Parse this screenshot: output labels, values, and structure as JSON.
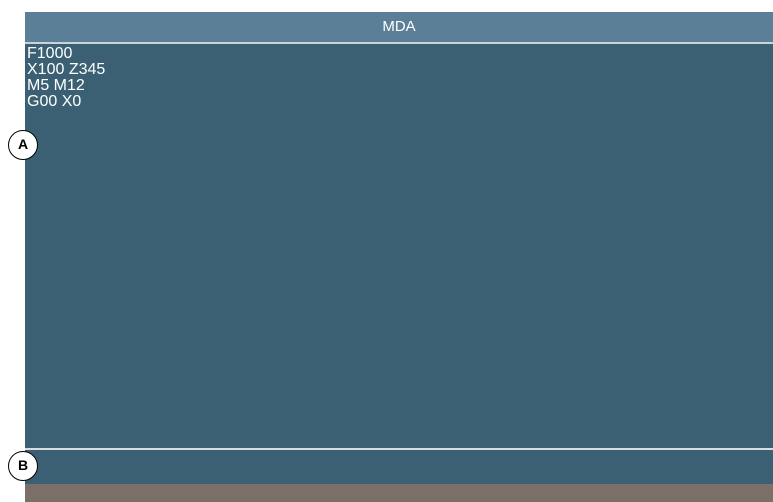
{
  "window": {
    "title": "MDA"
  },
  "editor": {
    "lines": [
      "F1000",
      "X100 Z345",
      "M5 M12",
      "G00 X0"
    ]
  },
  "input_line": {
    "value": ""
  },
  "callouts": {
    "a": "A",
    "b": "B"
  },
  "colors": {
    "title_bar": "#5a7f96",
    "editor_background": "#3b6074",
    "footer_bar": "#7a7067",
    "text": "#ffffff"
  }
}
